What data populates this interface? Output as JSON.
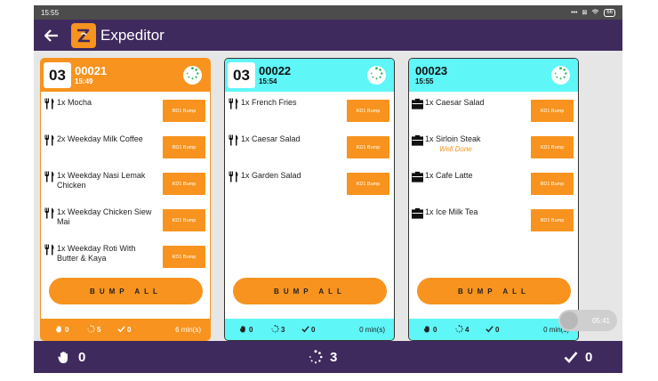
{
  "status_bar": {
    "time": "15:55",
    "battery": "66"
  },
  "app": {
    "title": "Expeditor"
  },
  "orders": [
    {
      "badge": "03",
      "order_no": "00021",
      "time": "15:49",
      "header_color": "#f7931e",
      "footer_color": "#f7931e",
      "items": [
        {
          "icon": "utensils-icon",
          "text": "1x Mocha",
          "modifier": "",
          "bump_label": "BD1 Bump"
        },
        {
          "icon": "utensils-icon",
          "text": "2x Weekday Milk Coffee",
          "modifier": "",
          "bump_label": "BD1 Bump"
        },
        {
          "icon": "utensils-icon",
          "text": "1x Weekday Nasi Lemak Chicken",
          "modifier": "",
          "bump_label": "KD1 Bump"
        },
        {
          "icon": "utensils-icon",
          "text": "1x Weekday Chicken Siew Mai",
          "modifier": "",
          "bump_label": "KD1 Bump"
        },
        {
          "icon": "utensils-icon",
          "text": "1x Weekday Roti With Butter & Kaya",
          "modifier": "",
          "bump_label": "KD1 Bump"
        }
      ],
      "bump_all_label": "BUMP ALL",
      "footer": {
        "hold": "0",
        "pending": "5",
        "done": "0",
        "elapsed": "6 min(s)"
      }
    },
    {
      "badge": "03",
      "order_no": "00022",
      "time": "15:54",
      "header_color": "#5ff6f8",
      "footer_color": "#5ff6f8",
      "items": [
        {
          "icon": "utensils-icon",
          "text": "1x French Fries",
          "modifier": "",
          "bump_label": "KD1 Bump"
        },
        {
          "icon": "utensils-icon",
          "text": "1x Caesar Salad",
          "modifier": "",
          "bump_label": "KD1 Bump"
        },
        {
          "icon": "utensils-icon",
          "text": "1x Garden Salad",
          "modifier": "",
          "bump_label": "KD1 Bump"
        }
      ],
      "bump_all_label": "BUMP ALL",
      "footer": {
        "hold": "0",
        "pending": "3",
        "done": "0",
        "elapsed": "0 min(s)"
      }
    },
    {
      "badge": "",
      "order_no": "00023",
      "time": "15:55",
      "header_color": "#5ff6f8",
      "footer_color": "#5ff6f8",
      "items": [
        {
          "icon": "takeaway-bag-icon",
          "text": "1x Caesar Salad",
          "modifier": "",
          "bump_label": "KD1 Bump"
        },
        {
          "icon": "takeaway-bag-icon",
          "text": "1x Sirloin Steak",
          "modifier": "Well Done",
          "bump_label": "KD1 Bump"
        },
        {
          "icon": "takeaway-bag-icon",
          "text": "1x Cafe Latte",
          "modifier": "",
          "bump_label": "BD1 Bump"
        },
        {
          "icon": "takeaway-bag-icon",
          "text": "1x Ice Milk Tea",
          "modifier": "",
          "bump_label": "BD1 Bump"
        }
      ],
      "bump_all_label": "BUMP ALL",
      "footer": {
        "hold": "0",
        "pending": "4",
        "done": "0",
        "elapsed": "0 min(s)"
      }
    }
  ],
  "floating_timer": "05:41",
  "summary": {
    "hold": "0",
    "pending": "3",
    "done": "0"
  },
  "colors": {
    "appbar": "#3f2a5e",
    "accent": "#f7931e",
    "cyan": "#5ff6f8"
  }
}
